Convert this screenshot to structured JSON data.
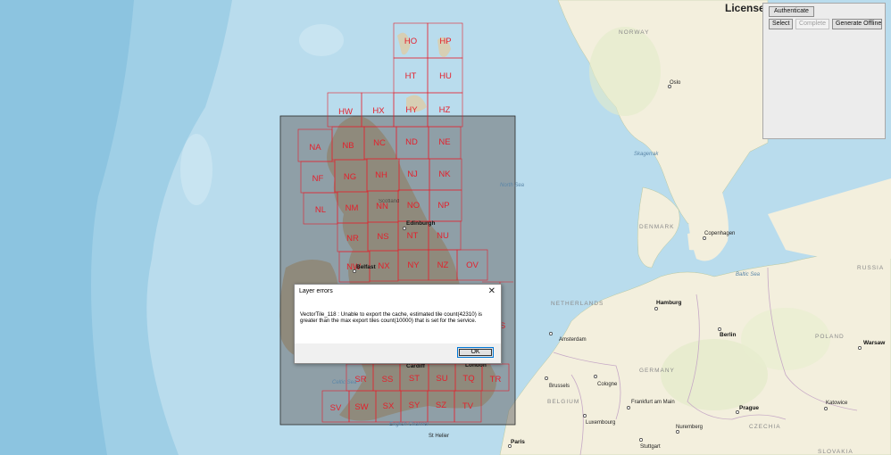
{
  "map": {
    "grid_cells": [
      {
        "id": "HO"
      },
      {
        "id": "HP"
      },
      {
        "id": "HT"
      },
      {
        "id": "HU"
      },
      {
        "id": "HW"
      },
      {
        "id": "HX"
      },
      {
        "id": "HY"
      },
      {
        "id": "HZ"
      },
      {
        "id": "NA"
      },
      {
        "id": "NB"
      },
      {
        "id": "NC"
      },
      {
        "id": "ND"
      },
      {
        "id": "NE"
      },
      {
        "id": "NF"
      },
      {
        "id": "NG"
      },
      {
        "id": "NH"
      },
      {
        "id": "NJ"
      },
      {
        "id": "NK"
      },
      {
        "id": "NL"
      },
      {
        "id": "NM"
      },
      {
        "id": "NN"
      },
      {
        "id": "NO"
      },
      {
        "id": "NP"
      },
      {
        "id": "NR"
      },
      {
        "id": "NS"
      },
      {
        "id": "NT"
      },
      {
        "id": "NU"
      },
      {
        "id": "NW"
      },
      {
        "id": "NX"
      },
      {
        "id": "NY"
      },
      {
        "id": "NZ"
      },
      {
        "id": "OV"
      },
      {
        "id": "SR"
      },
      {
        "id": "SS"
      },
      {
        "id": "ST"
      },
      {
        "id": "SU"
      },
      {
        "id": "TQ"
      },
      {
        "id": "TR"
      },
      {
        "id": "SV"
      },
      {
        "id": "SW"
      },
      {
        "id": "SX"
      },
      {
        "id": "SY"
      },
      {
        "id": "SZ"
      },
      {
        "id": "TV"
      },
      {
        "id": "S"
      }
    ],
    "places": [
      "Oslo",
      "Copenhagen",
      "Hamburg",
      "Berlin",
      "Warsaw",
      "Amsterdam",
      "Brussels",
      "Cologne",
      "Frankfurt am Main",
      "Prague",
      "Katowice",
      "Nuremberg",
      "Stuttgart",
      "Paris",
      "Luxembourg",
      "Edinburgh",
      "Belfast",
      "Cardiff",
      "London",
      "Scotland",
      "St Helier"
    ],
    "countries": [
      "NORWAY",
      "DENMARK",
      "NETHERLANDS",
      "GERMANY",
      "POLAND",
      "BELGIUM",
      "CZECHIA",
      "SLOVAKIA",
      "RUSSIA"
    ],
    "seas": [
      "North Sea",
      "Skagerrak",
      "Baltic Sea",
      "Celtic Sea",
      "English Channel"
    ],
    "colors": {
      "grid": "#e4202c",
      "extent_fill": "#6e6e6e",
      "water": "#b9dced",
      "land": "#f3efdd"
    }
  },
  "license_label": "License",
  "toolbar": {
    "authenticate": "Authenticate",
    "select": "Select",
    "complete": "Complete",
    "generate_offline": "Generate Offline"
  },
  "dialog": {
    "title": "Layer errors",
    "close": "✕",
    "message": "VectorTile_118 : Unable to export the cache, estimated tile count(42310) is greater than the max export tiles count(10000) that is set for the service.",
    "ok": "OK"
  }
}
